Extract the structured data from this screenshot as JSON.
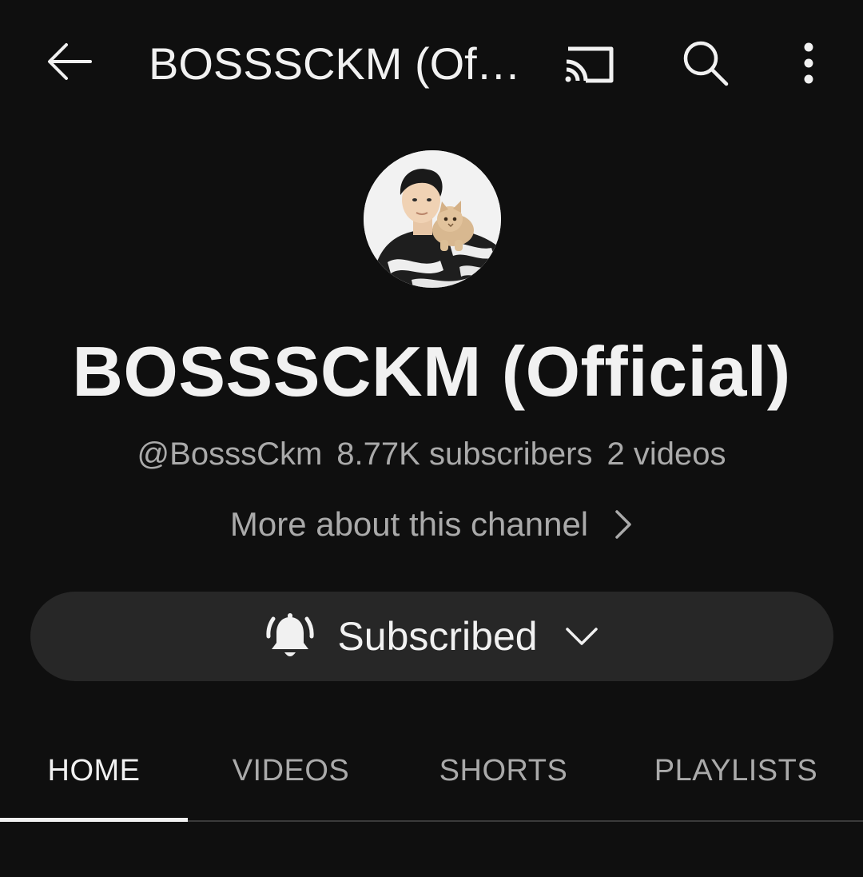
{
  "topbar": {
    "title": "BOSSSCKM (Official)",
    "icons": [
      "back-arrow-icon",
      "cast-icon",
      "search-icon",
      "more-vert-icon"
    ]
  },
  "channel": {
    "name": "BOSSSCKM (Official)",
    "handle": "@BosssCkm",
    "subscribers": "8.77K subscribers",
    "videos": "2 videos",
    "more_about": "More about this channel"
  },
  "subscribe": {
    "label": "Subscribed",
    "icon": "bell-ringing-icon"
  },
  "tabs": [
    {
      "label": "HOME",
      "active": true
    },
    {
      "label": "VIDEOS",
      "active": false
    },
    {
      "label": "SHORTS",
      "active": false
    },
    {
      "label": "PLAYLISTS",
      "active": false
    }
  ],
  "colors": {
    "background": "#0f0f0f",
    "text_primary": "#f1f1f1",
    "text_secondary": "#aaaaaa",
    "button_bg": "#272727"
  }
}
